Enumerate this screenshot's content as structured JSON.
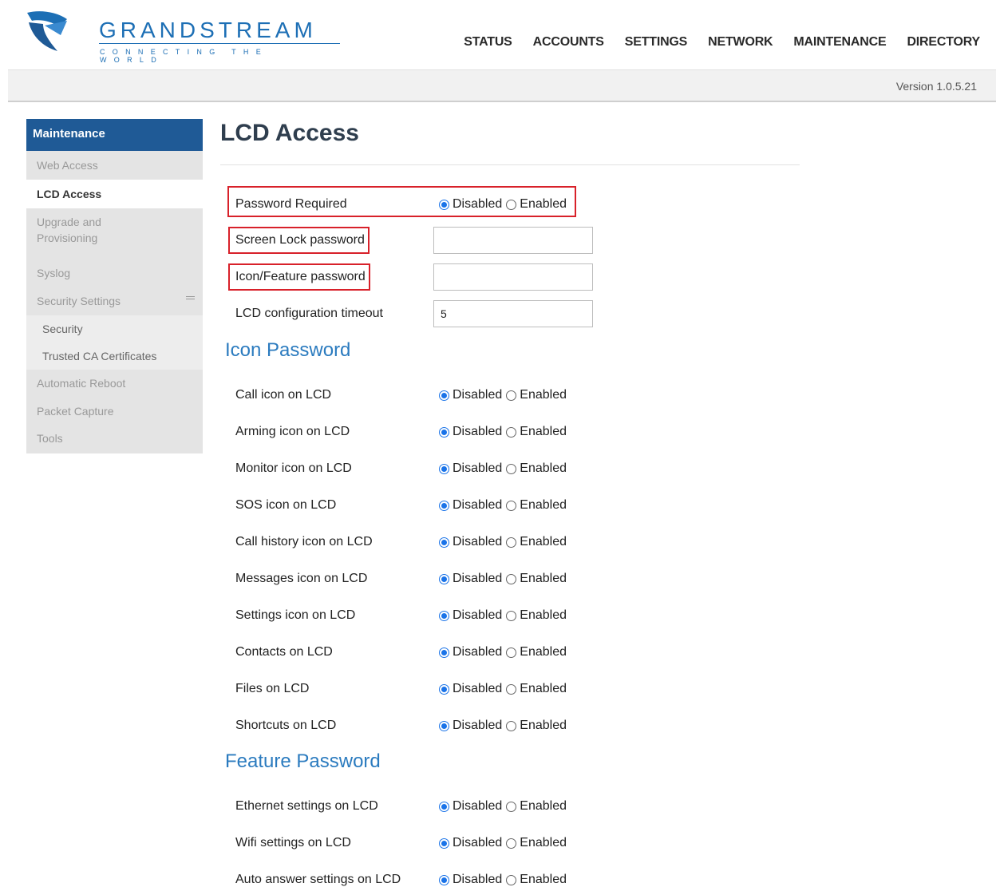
{
  "brand": {
    "name": "GRANDSTREAM",
    "tagline": "CONNECTING THE WORLD"
  },
  "topnav": [
    "STATUS",
    "ACCOUNTS",
    "SETTINGS",
    "NETWORK",
    "MAINTENANCE",
    "DIRECTORY"
  ],
  "version": "Version 1.0.5.21",
  "sidebar": {
    "header": "Maintenance",
    "items": [
      {
        "label": "Web Access"
      },
      {
        "label": "LCD Access",
        "active": true
      },
      {
        "label": "Upgrade and Provisioning"
      },
      {
        "label": "Syslog"
      },
      {
        "label": "Security Settings",
        "collapse": true
      },
      {
        "label": "Security",
        "sub": true
      },
      {
        "label": "Trusted CA Certificates",
        "sub": true
      },
      {
        "label": "Automatic Reboot"
      },
      {
        "label": "Packet Capture"
      },
      {
        "label": "Tools"
      }
    ]
  },
  "page": {
    "title": "LCD Access",
    "options": {
      "disabled": "Disabled",
      "enabled": "Enabled"
    },
    "password_required": {
      "label": "Password Required",
      "value": "Disabled"
    },
    "screen_lock_password": {
      "label": "Screen Lock password",
      "value": ""
    },
    "icon_feature_password": {
      "label": "Icon/Feature password",
      "value": ""
    },
    "lcd_config_timeout": {
      "label": "LCD configuration timeout",
      "value": "5"
    },
    "icon_password": {
      "heading": "Icon Password",
      "rows": [
        {
          "label": "Call icon on LCD",
          "value": "Disabled"
        },
        {
          "label": "Arming icon on LCD",
          "value": "Disabled"
        },
        {
          "label": "Monitor icon on LCD",
          "value": "Disabled"
        },
        {
          "label": "SOS icon on LCD",
          "value": "Disabled"
        },
        {
          "label": "Call history icon on LCD",
          "value": "Disabled"
        },
        {
          "label": "Messages icon on LCD",
          "value": "Disabled"
        },
        {
          "label": "Settings icon on LCD",
          "value": "Disabled"
        },
        {
          "label": "Contacts on LCD",
          "value": "Disabled"
        },
        {
          "label": "Files on LCD",
          "value": "Disabled"
        },
        {
          "label": "Shortcuts on LCD",
          "value": "Disabled"
        }
      ]
    },
    "feature_password": {
      "heading": "Feature Password",
      "rows": [
        {
          "label": "Ethernet settings on LCD",
          "value": "Disabled"
        },
        {
          "label": "Wifi settings on LCD",
          "value": "Disabled"
        },
        {
          "label": "Auto answer settings on LCD",
          "value": "Disabled"
        }
      ]
    }
  },
  "colors": {
    "accent": "#1f5a96",
    "section": "#2b7bbf",
    "highlight": "#d8212a",
    "radio": "#1a73e8"
  }
}
